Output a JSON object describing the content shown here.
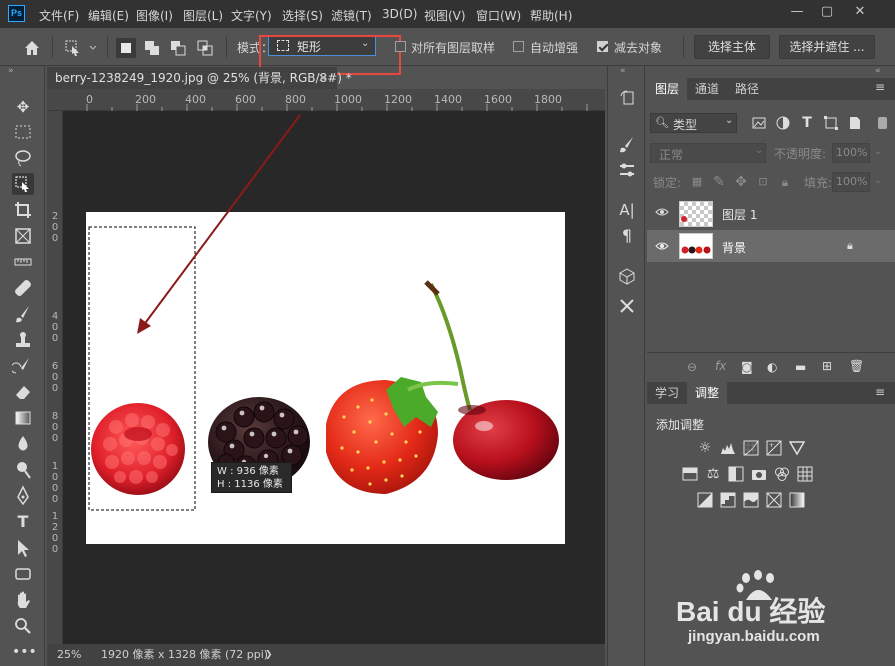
{
  "app": {
    "logo": "Ps"
  },
  "menu": [
    "文件(F)",
    "编辑(E)",
    "图像(I)",
    "图层(L)",
    "文字(Y)",
    "选择(S)",
    "滤镜(T)",
    "3D(D)",
    "视图(V)",
    "窗口(W)",
    "帮助(H)"
  ],
  "window_controls": {
    "minimize": "—",
    "restore": "▢",
    "close": "✕"
  },
  "options": {
    "mode_label": "模式：",
    "mode_value": "矩形",
    "sample_all_layers": {
      "label": "对所有图层取样",
      "checked": false
    },
    "auto_enhance": {
      "label": "自动增强",
      "checked": false
    },
    "subtract_object": {
      "label": "减去对象",
      "checked": true
    },
    "select_subject": "选择主体",
    "select_and_mask": "选择并遮住 ..."
  },
  "document": {
    "tab_title": "berry-1238249_1920.jpg @ 25% (背景, RGB/8#) *",
    "close": "✕",
    "ruler_h": [
      "0",
      "200",
      "400",
      "600",
      "800",
      "1000",
      "1200",
      "1400",
      "1600",
      "1800"
    ],
    "ruler_v": [
      "2",
      "0",
      "0",
      "4",
      "0",
      "0",
      "6",
      "0",
      "0",
      "8",
      "0",
      "0",
      "1",
      "0",
      "0",
      "0",
      "1",
      "2",
      "0",
      "0"
    ],
    "selection_info": {
      "w": "W :   936 像素",
      "h": "H :  1136 像素"
    }
  },
  "status": {
    "zoom": "25%",
    "info": "1920 像素 x 1328 像素 (72 ppi)",
    "arrow": "❯"
  },
  "panels": {
    "layers_tabs": [
      "图层",
      "通道",
      "路径"
    ],
    "filter_type": "类型",
    "blend_mode": "正常",
    "opacity_label": "不透明度:",
    "opacity_value": "100%",
    "lock_label": "锁定:",
    "fill_label": "填充:",
    "fill_value": "100%",
    "layers": [
      {
        "name": "图层 1",
        "selected": false
      },
      {
        "name": "背景",
        "selected": true
      }
    ],
    "bottom_tabs": [
      "学习",
      "调整"
    ],
    "adjust_title": "添加调整"
  },
  "watermark": {
    "brand": "Bai du 经验",
    "url": "jingyan.baidu.com"
  },
  "colors": {
    "highlight_box": "#e8473f",
    "arrow": "#8b1a1a",
    "panel_bg": "#535353",
    "canvas_bg": "#282828"
  }
}
